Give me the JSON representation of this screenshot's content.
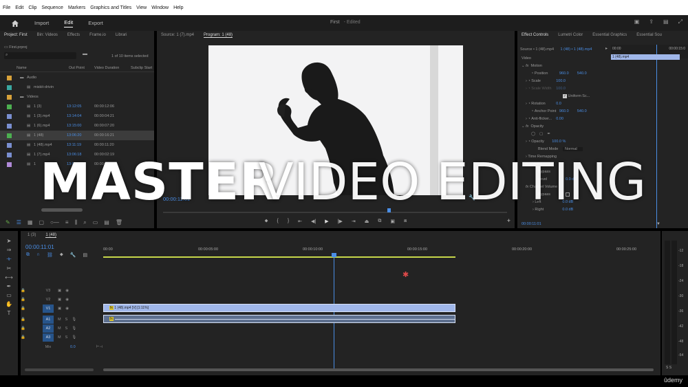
{
  "menu": [
    "File",
    "Edit",
    "Clip",
    "Sequence",
    "Markers",
    "Graphics and Titles",
    "View",
    "Window",
    "Help"
  ],
  "workspaces": {
    "import": "Import",
    "edit": "Edit",
    "export": "Export"
  },
  "project_title": "First",
  "project_status": "- Edited",
  "project_panel": {
    "tabs": [
      "Project: First",
      "Bin: Videos",
      "Effects",
      "Frame.io",
      "Librari"
    ],
    "file": "First.prproj",
    "selected_count": "1 of 10 items selected",
    "columns": [
      "Name",
      "Out Point",
      "Video Duration",
      "Subclip Start"
    ],
    "items": [
      {
        "name": "Audio",
        "out": "",
        "dur": "",
        "color": "#d8a23a"
      },
      {
        "name": "miskit-drivin",
        "out": "",
        "dur": "",
        "color": "#3aa8a0"
      },
      {
        "name": "Videos",
        "out": "",
        "dur": "",
        "color": "#d8a23a"
      },
      {
        "name": "1 (3)",
        "out": "13:12:05",
        "dur": "00:00:12:06",
        "color": "#4caf50"
      },
      {
        "name": "1 (3).mp4",
        "out": "13:14:04",
        "dur": "00:00:04:21",
        "color": "#7a8fd0"
      },
      {
        "name": "1 (6).mp4",
        "out": "13:15:00",
        "dur": "00:00:07:20",
        "color": "#7a8fd0"
      },
      {
        "name": "1 (48)",
        "out": "13:06:20",
        "dur": "00:00:16:21",
        "color": "#4caf50"
      },
      {
        "name": "1 (48).mp4",
        "out": "13:11:19",
        "dur": "00:00:11:20",
        "color": "#7a8fd0"
      },
      {
        "name": "1 (7).mp4",
        "out": "13:06:18",
        "dur": "00:00:02:19",
        "color": "#7a8fd0"
      },
      {
        "name": "1",
        "out": "13:0",
        "dur": "00:00:05:1",
        "color": "#b08ad8"
      }
    ]
  },
  "source_tab": "Source: 1 (7).mp4",
  "program_tab": "Program: 1 (48)",
  "program_timecode": "00:00:11:01",
  "program_fraction": "1/4",
  "effect_controls": {
    "tabs": [
      "Effect Controls",
      "Lumetri Color",
      "Essential Graphics",
      "Essential Sou"
    ],
    "source": "Source • 1 (48).mp4",
    "clip": "1 (48) • 1 (48).mp4",
    "mini_time": "00:00",
    "mini_time_right": "00:00:15:0",
    "clip_bar": "1 (48).mp4",
    "video_label": "Video",
    "motion": "Motion",
    "position_label": "Position",
    "position_x": "960.0",
    "position_y": "540.0",
    "scale_label": "Scale",
    "scale": "100.0",
    "scale_width_label": "Scale Width",
    "scale_width": "100.0",
    "uniform": "Uniform Sc...",
    "rotation_label": "Rotation",
    "rotation": "0.0",
    "anchor_label": "Anchor Point",
    "anchor_x": "960.0",
    "anchor_y": "540.0",
    "flicker_label": "Anti-flicker...",
    "flicker": "0.00",
    "opacity_section": "Opacity",
    "opacity_label": "Opacity",
    "opacity": "100.0 %",
    "blend_label": "Blend Mode",
    "blend": "Normal",
    "time_remap": "Time Remapping",
    "volume": "Volume",
    "bypass1": "Bypass",
    "level": "Level",
    "level_value": "0.0 dB",
    "channel_volume": "Channel Volume",
    "bypass2": "Bypass",
    "left": "Left",
    "left_value": "0.0 dB",
    "right": "Right",
    "right_value": "0.0 dB",
    "bottom_time": "00:00:11:01"
  },
  "timeline": {
    "tabs": [
      "1 (3)",
      "1 (48)"
    ],
    "timecode": "00:00:11:01",
    "ruler": [
      "00:00",
      "00:00:05:00",
      "00:00:10:00",
      "00:00:15:00",
      "00:00:20:00",
      "00:00:25:00"
    ],
    "video_tracks": [
      "V3",
      "V2",
      "V1"
    ],
    "audio_tracks": [
      "A1",
      "A2",
      "A3"
    ],
    "mix_label": "Mix",
    "mix_value": "0.0",
    "clip_label": "1 (48).mp4 [V] [1:11%]",
    "meter_labels": [
      "-12",
      "-18",
      "-24",
      "-30",
      "-36",
      "-42",
      "-48",
      "-54"
    ],
    "meter_bottom": "S S"
  },
  "overlay_title_bold": "MASTER",
  "overlay_title_light": "VIDEO EDITING",
  "watermark": "ûdemy",
  "colors": {
    "accent": "#4a8ee6",
    "panel": "#232323",
    "bg": "#1d1d1d",
    "clip": "#a0b7ea",
    "playhead": "#4a8ee6"
  }
}
